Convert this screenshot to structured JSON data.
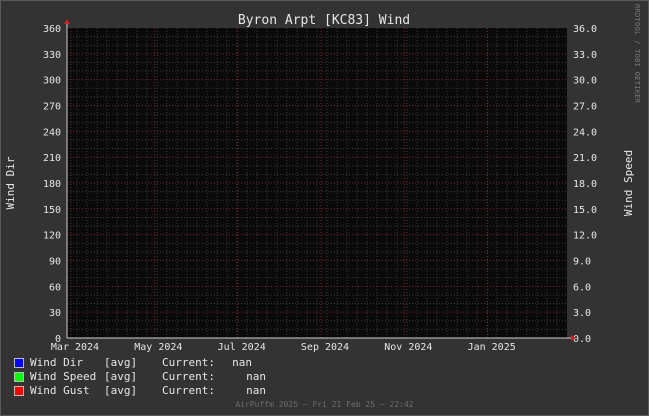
{
  "colors": {
    "background": "#333333",
    "plot_background": "#0a0a0a",
    "major_grid": "#7a2424",
    "minor_grid": "#3a3a3a",
    "text": "#e6e6e6",
    "wind_dir": "#0000ff",
    "wind_speed": "#00ff00",
    "wind_gust": "#ff0000"
  },
  "watermark": "RRDTOOL / TOBI OETIKER",
  "footer": "AirPuffm 2025 – Fri 21 Feb 25 – 22:42",
  "legend": [
    {
      "name": "Wind Dir",
      "stat": "[avg]",
      "current_label": "Current:",
      "value": "nan",
      "color_key": "wind_dir"
    },
    {
      "name": "Wind Speed",
      "stat": "[avg]",
      "current_label": "Current:",
      "value": "nan",
      "color_key": "wind_speed"
    },
    {
      "name": "Wind Gust",
      "stat": "[avg]",
      "current_label": "Current:",
      "value": "nan",
      "color_key": "wind_gust"
    }
  ],
  "chart_data": {
    "type": "line",
    "title": "Byron Arpt [KC83] Wind",
    "ylabel": "Wind Dir",
    "y2label": "Wind Speed",
    "ylim": [
      0,
      360
    ],
    "y2lim": [
      0,
      36
    ],
    "yticks": [
      "0",
      "30",
      "60",
      "90",
      "120",
      "150",
      "180",
      "210",
      "240",
      "270",
      "300",
      "330",
      "360"
    ],
    "y2ticks": [
      "0.0",
      "3.0",
      "6.0",
      "9.0",
      "12.0",
      "15.0",
      "18.0",
      "21.0",
      "24.0",
      "27.0",
      "30.0",
      "33.0",
      "36.0"
    ],
    "xticks": [
      "Mar 2024",
      "May 2024",
      "Jul 2024",
      "Sep 2024",
      "Nov 2024",
      "Jan 2025"
    ],
    "grid": true,
    "legend_position": "bottom-left",
    "series": [
      {
        "name": "Wind Dir",
        "axis": "left",
        "values": []
      },
      {
        "name": "Wind Speed",
        "axis": "right",
        "values": []
      },
      {
        "name": "Wind Gust",
        "axis": "right",
        "values": []
      }
    ]
  }
}
